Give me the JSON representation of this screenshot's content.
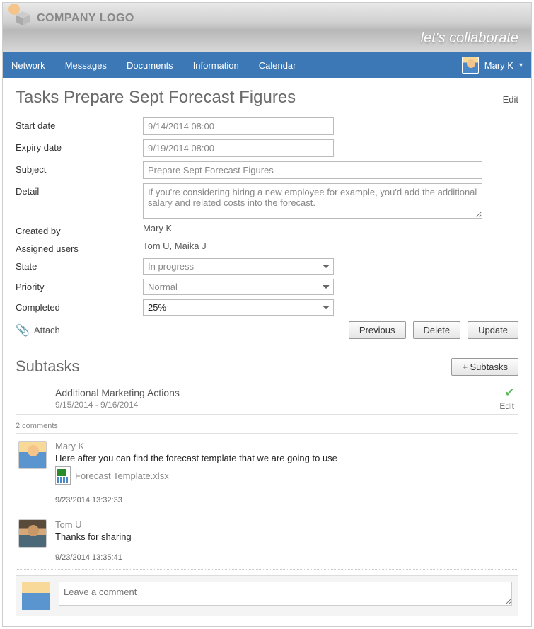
{
  "header": {
    "logo_text": "COMPANY LOGO",
    "tagline": "let's collaborate"
  },
  "nav": {
    "items": [
      "Network",
      "Messages",
      "Documents",
      "Information",
      "Calendar"
    ],
    "user_name": "Mary K"
  },
  "task": {
    "title": "Tasks Prepare Sept Forecast Figures",
    "edit_label": "Edit",
    "labels": {
      "start_date": "Start date",
      "expiry_date": "Expiry date",
      "subject": "Subject",
      "detail": "Detail",
      "created_by": "Created by",
      "assigned_users": "Assigned users",
      "state": "State",
      "priority": "Priority",
      "completed": "Completed"
    },
    "values": {
      "start_date": "9/14/2014 08:00",
      "expiry_date": "9/19/2014 08:00",
      "subject": "Prepare Sept Forecast Figures",
      "detail": "If you're considering hiring a new employee for example, you'd add the additional salary and related costs into the forecast.",
      "created_by": "Mary K",
      "assigned_users": "Tom U, Maika J",
      "state": "In progress",
      "priority": "Normal",
      "completed": "25%"
    },
    "attach_label": "Attach",
    "buttons": {
      "previous": "Previous",
      "delete": "Delete",
      "update": "Update"
    }
  },
  "subtasks": {
    "title": "Subtasks",
    "add_label": "+ Subtasks",
    "items": [
      {
        "title": "Additional Marketing Actions",
        "dates": "9/15/2014 - 9/16/2014",
        "edit": "Edit"
      }
    ]
  },
  "comments": {
    "count_label": "2 comments",
    "items": [
      {
        "author": "Mary K",
        "text": "Here after you can find the forecast template that we are going to use",
        "attachment": "Forecast Template.xlsx",
        "time": "9/23/2014 13:32:33",
        "avatar": "f"
      },
      {
        "author": "Tom U",
        "text": "Thanks for sharing",
        "attachment": null,
        "time": "9/23/2014 13:35:41",
        "avatar": "m"
      }
    ],
    "placeholder": "Leave a comment"
  }
}
